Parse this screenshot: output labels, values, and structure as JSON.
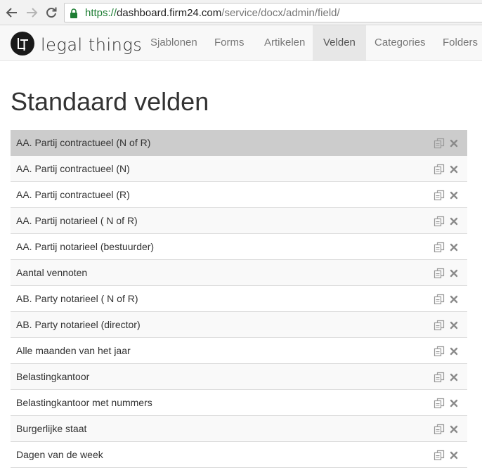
{
  "browser": {
    "url_scheme": "https://",
    "url_host": "dashboard.firm24.com",
    "url_path": "/service/docx/admin/field/"
  },
  "app": {
    "logo_text": "legal things",
    "nav": [
      {
        "label": "Sjablonen",
        "active": false
      },
      {
        "label": "Forms",
        "active": false
      },
      {
        "label": "Artikelen",
        "active": false
      },
      {
        "label": "Velden",
        "active": true
      },
      {
        "label": "Categories",
        "active": false
      },
      {
        "label": "Folders",
        "active": false
      }
    ]
  },
  "page": {
    "title": "Standaard velden"
  },
  "fields": [
    {
      "name": "AA. Partij contractueel (N of R)",
      "selected": true
    },
    {
      "name": "AA. Partij contractueel (N)",
      "selected": false
    },
    {
      "name": "AA. Partij contractueel (R)",
      "selected": false
    },
    {
      "name": "AA. Partij notarieel ( N of R)",
      "selected": false
    },
    {
      "name": "AA. Partij notarieel (bestuurder)",
      "selected": false
    },
    {
      "name": "Aantal vennoten",
      "selected": false
    },
    {
      "name": "AB. Party notarieel ( N of R)",
      "selected": false
    },
    {
      "name": "AB. Party notarieel (director)",
      "selected": false
    },
    {
      "name": "Alle maanden van het jaar",
      "selected": false
    },
    {
      "name": "Belastingkantoor",
      "selected": false
    },
    {
      "name": "Belastingkantoor met nummers",
      "selected": false
    },
    {
      "name": "Burgerlijke staat",
      "selected": false
    },
    {
      "name": "Dagen van de week",
      "selected": false
    }
  ],
  "icons": {
    "row_actions": [
      "copy-icon",
      "delete-icon"
    ],
    "browser": [
      "back-arrow-icon",
      "forward-arrow-icon",
      "reload-icon",
      "lock-icon"
    ]
  },
  "colors": {
    "selected_row": "#cccccc",
    "active_nav": "#e7e7e7",
    "secure_lock": "#1e7e34"
  }
}
